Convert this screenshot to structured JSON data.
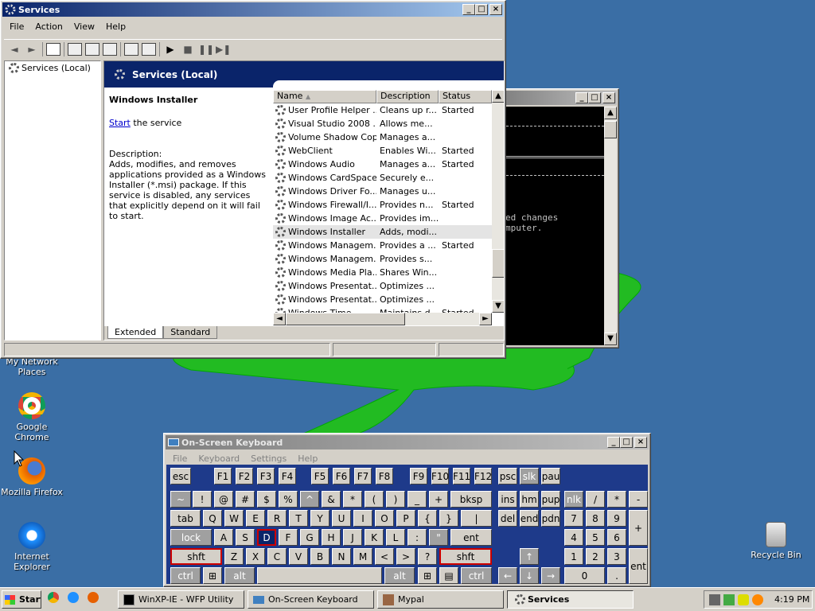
{
  "desktop": {
    "icons": [
      {
        "label": "My Network Places",
        "icon": "network-places-icon"
      },
      {
        "label": "Google Chrome",
        "icon": "chrome-icon"
      },
      {
        "label": "Mozilla Firefox",
        "icon": "firefox-icon"
      },
      {
        "label": "Internet Explorer",
        "icon": "ie-icon"
      },
      {
        "label": "Recycle Bin",
        "icon": "recycle-bin-icon"
      }
    ]
  },
  "services": {
    "title": "Services",
    "menu": [
      "File",
      "Action",
      "View",
      "Help"
    ],
    "tree_item": "Services (Local)",
    "header": "Services (Local)",
    "selected_name": "Windows Installer",
    "start_link": "Start",
    "start_rest": " the service",
    "desc_label": "Description:",
    "desc_text": "Adds, modifies, and removes applications provided as a Windows Installer (*.msi) package. If this service is disabled, any services that explicitly depend on it will fail to start.",
    "columns": {
      "name": "Name",
      "description": "Description",
      "status": "Status"
    },
    "rows": [
      {
        "name": "User Profile Helper ...",
        "desc": "Cleans up r...",
        "status": "Started"
      },
      {
        "name": "Visual Studio 2008 ...",
        "desc": "Allows me...",
        "status": ""
      },
      {
        "name": "Volume Shadow Copy",
        "desc": "Manages a...",
        "status": ""
      },
      {
        "name": "WebClient",
        "desc": "Enables Wi...",
        "status": "Started"
      },
      {
        "name": "Windows Audio",
        "desc": "Manages a...",
        "status": "Started"
      },
      {
        "name": "Windows CardSpace",
        "desc": "Securely e...",
        "status": ""
      },
      {
        "name": "Windows Driver Fo...",
        "desc": "Manages u...",
        "status": ""
      },
      {
        "name": "Windows Firewall/I...",
        "desc": "Provides n...",
        "status": "Started"
      },
      {
        "name": "Windows Image Ac...",
        "desc": "Provides im...",
        "status": ""
      },
      {
        "name": "Windows Installer",
        "desc": "Adds, modi...",
        "status": ""
      },
      {
        "name": "Windows Managem...",
        "desc": "Provides a ...",
        "status": "Started"
      },
      {
        "name": "Windows Managem...",
        "desc": "Provides s...",
        "status": ""
      },
      {
        "name": "Windows Media Pla...",
        "desc": "Shares Win...",
        "status": ""
      },
      {
        "name": "Windows Presentat...",
        "desc": "Optimizes ...",
        "status": ""
      },
      {
        "name": "Windows Presentat...",
        "desc": "Optimizes ...",
        "status": ""
      },
      {
        "name": "Windows Time",
        "desc": "Maintains d...",
        "status": "Started"
      }
    ],
    "selected_index": 9,
    "tabs": [
      "Extended",
      "Standard"
    ]
  },
  "console": {
    "line1": "ed changes",
    "line2": "mputer."
  },
  "osk": {
    "title": "On-Screen Keyboard",
    "menu": [
      "File",
      "Keyboard",
      "Settings",
      "Help"
    ]
  },
  "taskbar": {
    "start": "Start",
    "buttons": [
      "WinXP-IE - WFP Utility",
      "On-Screen Keyboard",
      "Mypal",
      "Services"
    ],
    "clock": "4:19 PM"
  },
  "colors": {
    "desktop": "#3a6ea5",
    "titlebar": "#0a246a",
    "shape": "#22bb22",
    "osk_bg": "#1e3a8a"
  }
}
